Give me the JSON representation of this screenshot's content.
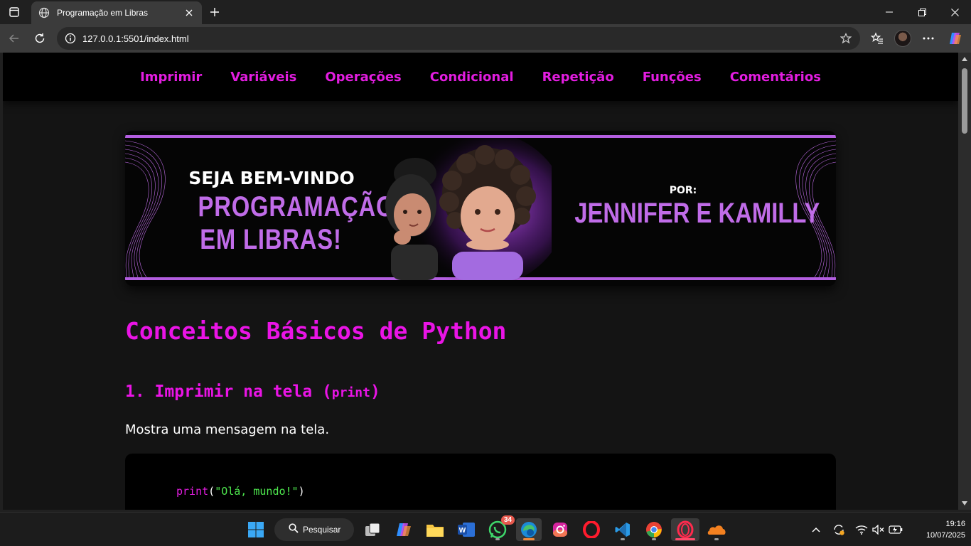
{
  "browser": {
    "tab_title": "Programação em Libras",
    "url": "127.0.0.1:5501/index.html"
  },
  "site": {
    "nav": [
      "Imprimir",
      "Variáveis",
      "Operações",
      "Condicional",
      "Repetição",
      "Funções",
      "Comentários"
    ],
    "banner": {
      "welcome": "SEJA BEM-VINDO",
      "title_line1": "PROGRAMAÇÃO",
      "title_line2": "EM LIBRAS!",
      "by": "POR:",
      "authors": "JENNIFER E KAMILLY"
    },
    "main_heading": "Conceitos Básicos de Python",
    "section1": {
      "heading_prefix": "1. Imprimir na tela (",
      "heading_code": "print",
      "heading_suffix": ")",
      "text": "Mostra uma mensagem na tela.",
      "code_fn": "print",
      "code_open": "(",
      "code_string": "\"Olá, mundo!\"",
      "code_close": ")"
    }
  },
  "taskbar": {
    "search_label": "Pesquisar",
    "whatsapp_badge": "34",
    "time": "19:16",
    "date": "10/07/2025"
  },
  "colors": {
    "accent_magenta": "#e31de0",
    "banner_purple": "#c06ce8",
    "code_string_green": "#4ee84e"
  }
}
